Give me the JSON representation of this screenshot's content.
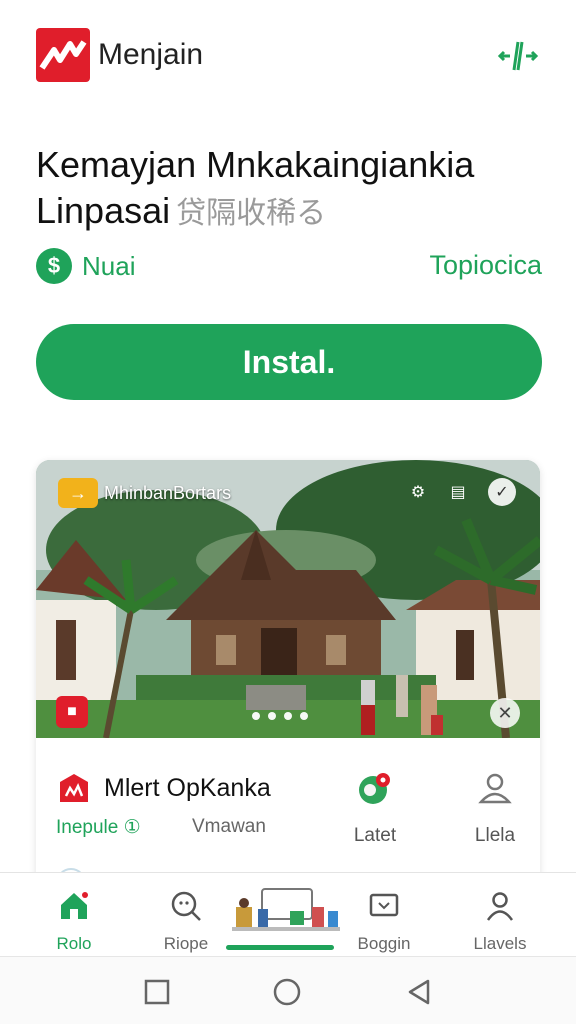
{
  "header": {
    "app_name": "Menjain",
    "logo_icon": "store-logo-icon",
    "action_icon": "expand-icon"
  },
  "app": {
    "title_line1": "Kemayjan Mnkakaingiankia",
    "title_line2": "Linpasai",
    "title_sub": "贷隔收稀る",
    "price_label": "Nuai",
    "category": "Topiocica",
    "install_label": "Instal."
  },
  "card": {
    "tag_text": "MhinbanBortars",
    "title": "Mlert OpKanka",
    "link_primary": "Inepule ①",
    "link_secondary": "Vmawan",
    "col1_label": "Latet",
    "col2_label": "Llela",
    "carousel": {
      "pages": 4,
      "active": 0
    }
  },
  "bottom_nav": {
    "items": [
      {
        "label": "Rolo",
        "icon": "home-icon",
        "active": true
      },
      {
        "label": "Riope",
        "icon": "search-icon",
        "active": false
      },
      {
        "label": "Boggin",
        "icon": "screen-icon",
        "active": false
      },
      {
        "label": "Llavels",
        "icon": "person-icon",
        "active": false
      }
    ]
  },
  "colors": {
    "accent": "#1fa35a",
    "brand_red": "#e01e2b",
    "tag_yellow": "#f2b21b"
  }
}
